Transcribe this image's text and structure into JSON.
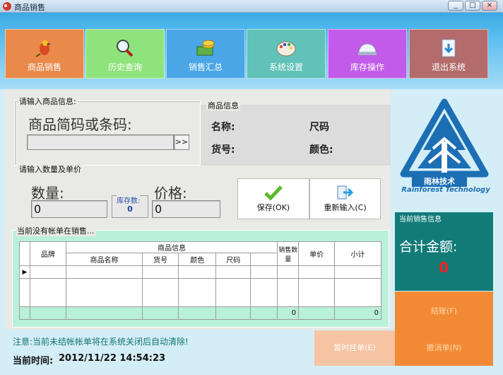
{
  "window": {
    "title": "商品销售",
    "controls": [
      "_",
      "□",
      "×"
    ]
  },
  "nav": [
    {
      "label": "商品销售",
      "color": "#e98a4a",
      "icon": "bird-icon"
    },
    {
      "label": "历史查询",
      "color": "#8fe37c",
      "icon": "magnifier-icon"
    },
    {
      "label": "销售汇总",
      "color": "#4aa6e7",
      "icon": "money-icon"
    },
    {
      "label": "系统设置",
      "color": "#60c2b8",
      "icon": "palette-icon"
    },
    {
      "label": "库存操作",
      "color": "#c25be9",
      "icon": "globe-icon"
    },
    {
      "label": "退出系统",
      "color": "#b36b6b",
      "icon": "exit-icon"
    }
  ],
  "input_section": {
    "legend": "请输入商品信息:",
    "prompt": "商品简码或条码:",
    "code_value": "",
    "browse_label": ">>"
  },
  "product_info": {
    "legend": "商品信息",
    "name_label": "名称:",
    "size_label": "尺码",
    "item_no_label": "货号:",
    "color_label": "颜色:"
  },
  "qty_section": {
    "legend": "请输入数量及单价",
    "qty_label": "数量:",
    "qty_value": "0",
    "stock_label": "库存数:",
    "stock_value": "0",
    "price_label": "价格:",
    "price_value": "0"
  },
  "actions": {
    "save": "保存(OK)",
    "reset": "重新输入(C)"
  },
  "logo": {
    "cn": "雨林技术",
    "en": "Rainforest Technology"
  },
  "current_sales": {
    "legend": "当前销售信息",
    "total_label": "合计金额:",
    "total_value": "0"
  },
  "bill": {
    "legend": "当前没有帐单在销售...",
    "headers": {
      "brand": "品牌",
      "product_info": "商品信息",
      "product_name": "商品名称",
      "item_no": "货号",
      "color": "颜色",
      "size": "尺码",
      "qty": "销售数量",
      "unit_price": "单价",
      "subtotal": "小计"
    },
    "row_marker": "▶",
    "footer_qty": "0",
    "footer_subtotal": "0"
  },
  "notice": "注意:当前未结帐帐单将在系统关闭后自动清除!",
  "time": {
    "label": "当前时间:",
    "value": "2012/11/22 14:54:23"
  },
  "bottom_buttons": {
    "checkout": "结账(F)",
    "hold": "暂时挂单(E)",
    "cancel": "撤消单(N)"
  }
}
